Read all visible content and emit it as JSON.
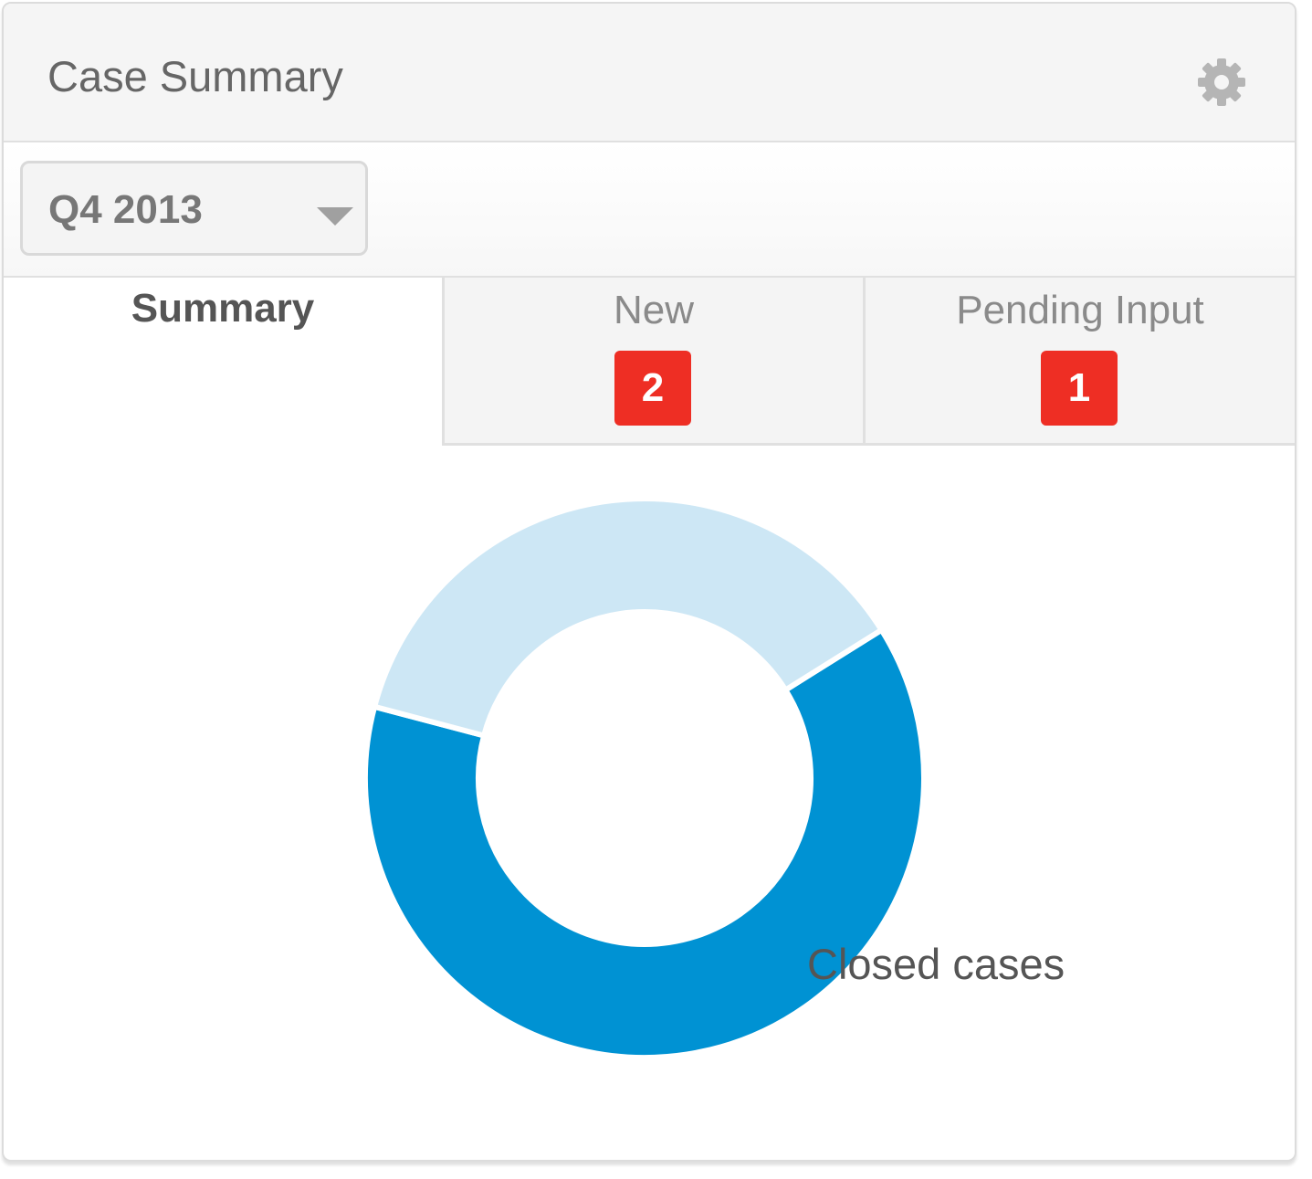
{
  "header": {
    "title": "Case Summary",
    "settings_icon": "gear-icon"
  },
  "filter": {
    "selected": "Q4 2013",
    "caret_icon": "caret-down-icon"
  },
  "tabs": [
    {
      "label": "Summary",
      "active": true
    },
    {
      "label": "New",
      "badge": "2",
      "badge_color": "#ee2e24"
    },
    {
      "label": "Pending Input",
      "badge": "1",
      "badge_color": "#ee2e24"
    }
  ],
  "chart_data": {
    "type": "pie",
    "variant": "donut",
    "series": [
      {
        "label": "",
        "value": 63,
        "color": "#0092d3"
      },
      {
        "label": "Closed cases",
        "value": 37,
        "color": "#cde7f5"
      }
    ]
  }
}
